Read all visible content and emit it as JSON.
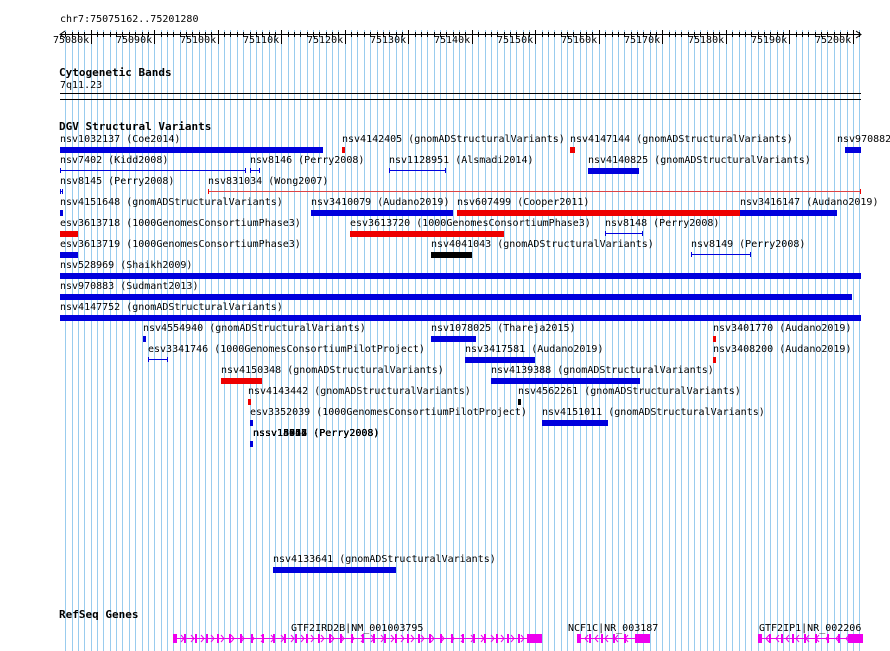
{
  "locus": "chr7:75075162..75201280",
  "scale": {
    "bp_start": 75075162,
    "bp_end": 75201280,
    "ticks": [
      {
        "bp": 75080000,
        "label": "75080k"
      },
      {
        "bp": 75090000,
        "label": "75090k"
      },
      {
        "bp": 75100000,
        "label": "75100k"
      },
      {
        "bp": 75110000,
        "label": "75110k"
      },
      {
        "bp": 75120000,
        "label": "75120k"
      },
      {
        "bp": 75130000,
        "label": "75130k"
      },
      {
        "bp": 75140000,
        "label": "75140k"
      },
      {
        "bp": 75150000,
        "label": "75150k"
      },
      {
        "bp": 75160000,
        "label": "75160k"
      },
      {
        "bp": 75170000,
        "label": "75170k"
      },
      {
        "bp": 75180000,
        "label": "75180k"
      },
      {
        "bp": 75190000,
        "label": "75190k"
      },
      {
        "bp": 75200000,
        "label": "75200k"
      }
    ]
  },
  "colors": {
    "gain": "#0000dd",
    "loss": "#ee0000",
    "complex": "#000000",
    "gene": "#ee00ee",
    "grid": "#99ccee",
    "reddish_line": "#dd4444"
  },
  "tracks": {
    "cytoband": {
      "title": "Cytogenetic Bands",
      "band_label": "7q11.23"
    },
    "dgv": {
      "title": "DGV Structural Variants",
      "features": [
        {
          "label": "nsv1032137 (Coe2014)",
          "start": 75075162,
          "end": 75116500,
          "color": "gain",
          "style": "bar"
        },
        {
          "label": "nsv4142405 (gnomADStructuralVariants)",
          "start": 75119500,
          "end": 75119900,
          "color": "loss",
          "style": "bar"
        },
        {
          "label": "nsv4147144 (gnomADStructuralVariants)",
          "start": 75155500,
          "end": 75156200,
          "color": "loss",
          "style": "bar"
        },
        {
          "label": "nsv970882",
          "start": 75198800,
          "end": 75201280,
          "color": "gain",
          "style": "bar"
        },
        {
          "label": "nsv7402 (Kidd2008)",
          "start": 75075162,
          "end": 75104500,
          "color": "gain",
          "style": "line"
        },
        {
          "label": "nsv8146 (Perry2008)",
          "start": 75105000,
          "end": 75106700,
          "color": "gain",
          "style": "line"
        },
        {
          "label": "nsv1128951 (Alsmadi2014)",
          "start": 75127000,
          "end": 75136000,
          "color": "gain",
          "style": "line"
        },
        {
          "label": "nsv4140825 (gnomADStructuralVariants)",
          "start": 75158300,
          "end": 75166300,
          "color": "gain",
          "style": "bar"
        },
        {
          "label": "nsv8145 (Perry2008)",
          "start": 75075162,
          "end": 75075400,
          "color": "gain",
          "style": "line"
        },
        {
          "label": "nsv831034 (Wong2007)",
          "start": 75098400,
          "end": 75201280,
          "color": "loss",
          "style": "line"
        },
        {
          "label": "nsv4151648 (gnomADStructuralVariants)",
          "start": 75075162,
          "end": 75075400,
          "color": "gain",
          "style": "bar"
        },
        {
          "label": "nsv3410079 (Audano2019)",
          "start": 75114700,
          "end": 75137000,
          "color": "gain",
          "style": "bar"
        },
        {
          "label": "nsv607499 (Cooper2011)",
          "start": 75137700,
          "end": 75182300,
          "color": "loss",
          "style": "bar"
        },
        {
          "label": "nsv3416147 (Audano2019)",
          "start": 75182300,
          "end": 75197500,
          "color": "gain",
          "style": "bar"
        },
        {
          "label": "esv3613718 (1000GenomesConsortiumPhase3)",
          "start": 75075162,
          "end": 75078000,
          "color": "loss",
          "style": "bar"
        },
        {
          "label": "esv3613720 (1000GenomesConsortiumPhase3)",
          "start": 75120800,
          "end": 75145000,
          "color": "loss",
          "style": "bar"
        },
        {
          "label": "nsv8148 (Perry2008)",
          "start": 75161000,
          "end": 75167000,
          "color": "gain",
          "style": "line"
        },
        {
          "label": "esv3613719 (1000GenomesConsortiumPhase3)",
          "start": 75075162,
          "end": 75078000,
          "color": "gain",
          "style": "bar"
        },
        {
          "label": "nsv4041043 (gnomADStructuralVariants)",
          "start": 75133600,
          "end": 75140000,
          "color": "complex",
          "style": "bar"
        },
        {
          "label": "nsv8149 (Perry2008)",
          "start": 75174500,
          "end": 75184000,
          "color": "gain",
          "style": "line"
        },
        {
          "label": "nsv528969 (Shaikh2009)",
          "start": 75075162,
          "end": 75201280,
          "color": "gain",
          "style": "bar"
        },
        {
          "label": "nsv970883 (Sudmant2013)",
          "start": 75075162,
          "end": 75199800,
          "color": "gain",
          "style": "bar"
        },
        {
          "label": "nsv4147752 (gnomADStructuralVariants)",
          "start": 75075162,
          "end": 75201280,
          "color": "gain",
          "style": "bar"
        },
        {
          "label": "nsv4554940 (gnomADStructuralVariants)",
          "start": 75088200,
          "end": 75088500,
          "color": "gain",
          "style": "bar"
        },
        {
          "label": "nsv1078025 (Thareja2015)",
          "start": 75133600,
          "end": 75140700,
          "color": "gain",
          "style": "bar"
        },
        {
          "label": "nsv3401770 (Audano2019)",
          "start": 75178000,
          "end": 75178300,
          "color": "loss",
          "style": "bar"
        },
        {
          "label": "esv3341746 (1000GenomesConsortiumPilotProject)",
          "start": 75089000,
          "end": 75092200,
          "color": "gain",
          "style": "line"
        },
        {
          "label": "nsv3417581 (Audano2019)",
          "start": 75139000,
          "end": 75150000,
          "color": "gain",
          "style": "bar"
        },
        {
          "label": "nsv3408200 (Audano2019)",
          "start": 75178000,
          "end": 75178300,
          "color": "loss",
          "style": "bar"
        },
        {
          "label": "nsv4150348 (gnomADStructuralVariants)",
          "start": 75100500,
          "end": 75107000,
          "color": "loss",
          "style": "bar"
        },
        {
          "label": "nsv4139388 (gnomADStructuralVariants)",
          "start": 75143000,
          "end": 75166500,
          "color": "gain",
          "style": "bar"
        },
        {
          "label": "nsv4143442 (gnomADStructuralVariants)",
          "start": 75104800,
          "end": 75105200,
          "color": "loss",
          "style": "bar"
        },
        {
          "label": "nsv4562261 (gnomADStructuralVariants)",
          "start": 75147200,
          "end": 75147500,
          "color": "complex",
          "style": "bar"
        },
        {
          "label": "esv3352039 (1000GenomesConsortiumPilotProject)",
          "start": 75105100,
          "end": 75105500,
          "color": "gain",
          "style": "bar"
        },
        {
          "label": "nsv4151011 (gnomADStructuralVariants)",
          "start": 75151000,
          "end": 75161500,
          "color": "gain",
          "style": "bar"
        },
        {
          "label": "nssv14962 (Perry2008)",
          "start": 75105100,
          "end": 75105500,
          "color": "gain",
          "style": "bar"
        },
        {
          "label": "nssv15054 (Perry2008)",
          "start": 75105100,
          "end": 75105500,
          "color": "gain",
          "style": "bar"
        },
        {
          "label": "nssv15416 (Perry2008)",
          "start": 75105100,
          "end": 75105500,
          "color": "gain",
          "style": "bar"
        },
        {
          "label": "nssv15547 (Perry2008)",
          "start": 75105100,
          "end": 75105500,
          "color": "gain",
          "style": "bar"
        },
        {
          "label": "nssv15724 (Perry2008)",
          "start": 75105100,
          "end": 75105500,
          "color": "gain",
          "style": "bar"
        },
        {
          "label": "nssv18053 (Perry2008)",
          "start": 75105100,
          "end": 75105500,
          "color": "gain",
          "style": "bar"
        },
        {
          "label": "nsv4133641 (gnomADStructuralVariants)",
          "start": 75108700,
          "end": 75128000,
          "color": "gain",
          "style": "bar"
        }
      ]
    },
    "refseq": {
      "title": "RefSeq Genes",
      "genes": [
        {
          "label": "GTF2IRD2B|NM_001003795",
          "start": 75093000,
          "end": 75150700,
          "strand": "+"
        },
        {
          "label": "NCF1C|NR_003187",
          "start": 75156500,
          "end": 75167800,
          "strand": "-"
        },
        {
          "label": "GTF2IP1|NR_002206",
          "start": 75185000,
          "end": 75201280,
          "strand": "-"
        }
      ]
    }
  }
}
